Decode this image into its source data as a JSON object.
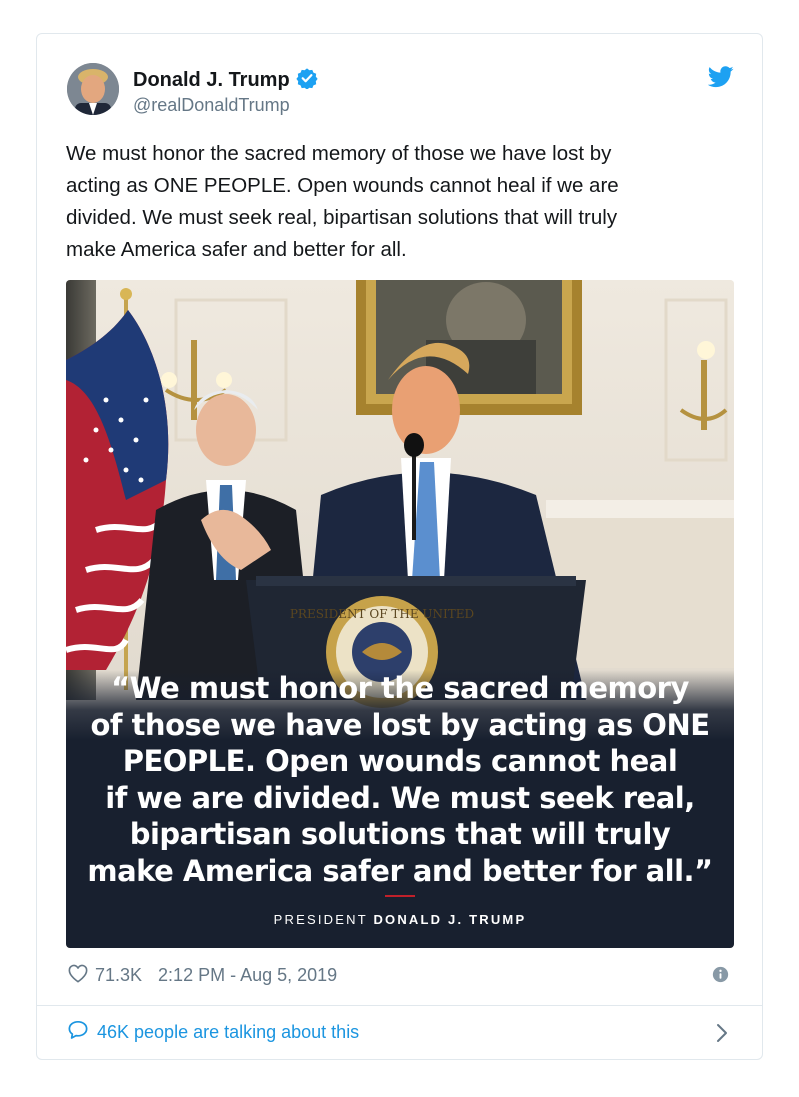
{
  "author": {
    "name": "Donald J. Trump",
    "handle": "@realDonaldTrump",
    "verified": true
  },
  "tweet": {
    "text_lines": [
      "We must honor the sacred memory of those we have lost by",
      "acting as ONE PEOPLE. Open wounds cannot heal if we are",
      "divided. We must seek real, bipartisan solutions that will truly",
      "make America safer and better for all."
    ]
  },
  "media": {
    "quote_lines": [
      "“We must honor the sacred memory",
      "of those we have lost by acting as ONE",
      "PEOPLE. Open wounds cannot heal",
      "if we are divided. We must seek real,",
      "bipartisan solutions that will truly",
      "make America safer and better for all.”"
    ],
    "attribution_prefix": "PRESIDENT ",
    "attribution_name": "DONALD J. TRUMP",
    "seal_text": "PRESIDENT OF THE UNITED"
  },
  "meta": {
    "likes": "71.3K",
    "timestamp": "2:12 PM - Aug 5, 2019"
  },
  "conversation": {
    "label": "46K people are talking about this"
  },
  "colors": {
    "link_blue": "#1b95e0",
    "verified_blue": "#1da1f2",
    "muted_gray": "#657786",
    "panel_navy": "#18202f",
    "accent_red": "#c0202a"
  },
  "icons": {
    "brand": "twitter-bird-icon",
    "verified": "verified-badge-icon",
    "like": "heart-icon",
    "info": "info-icon",
    "reply": "speech-bubble-icon",
    "more": "chevron-right-icon"
  }
}
